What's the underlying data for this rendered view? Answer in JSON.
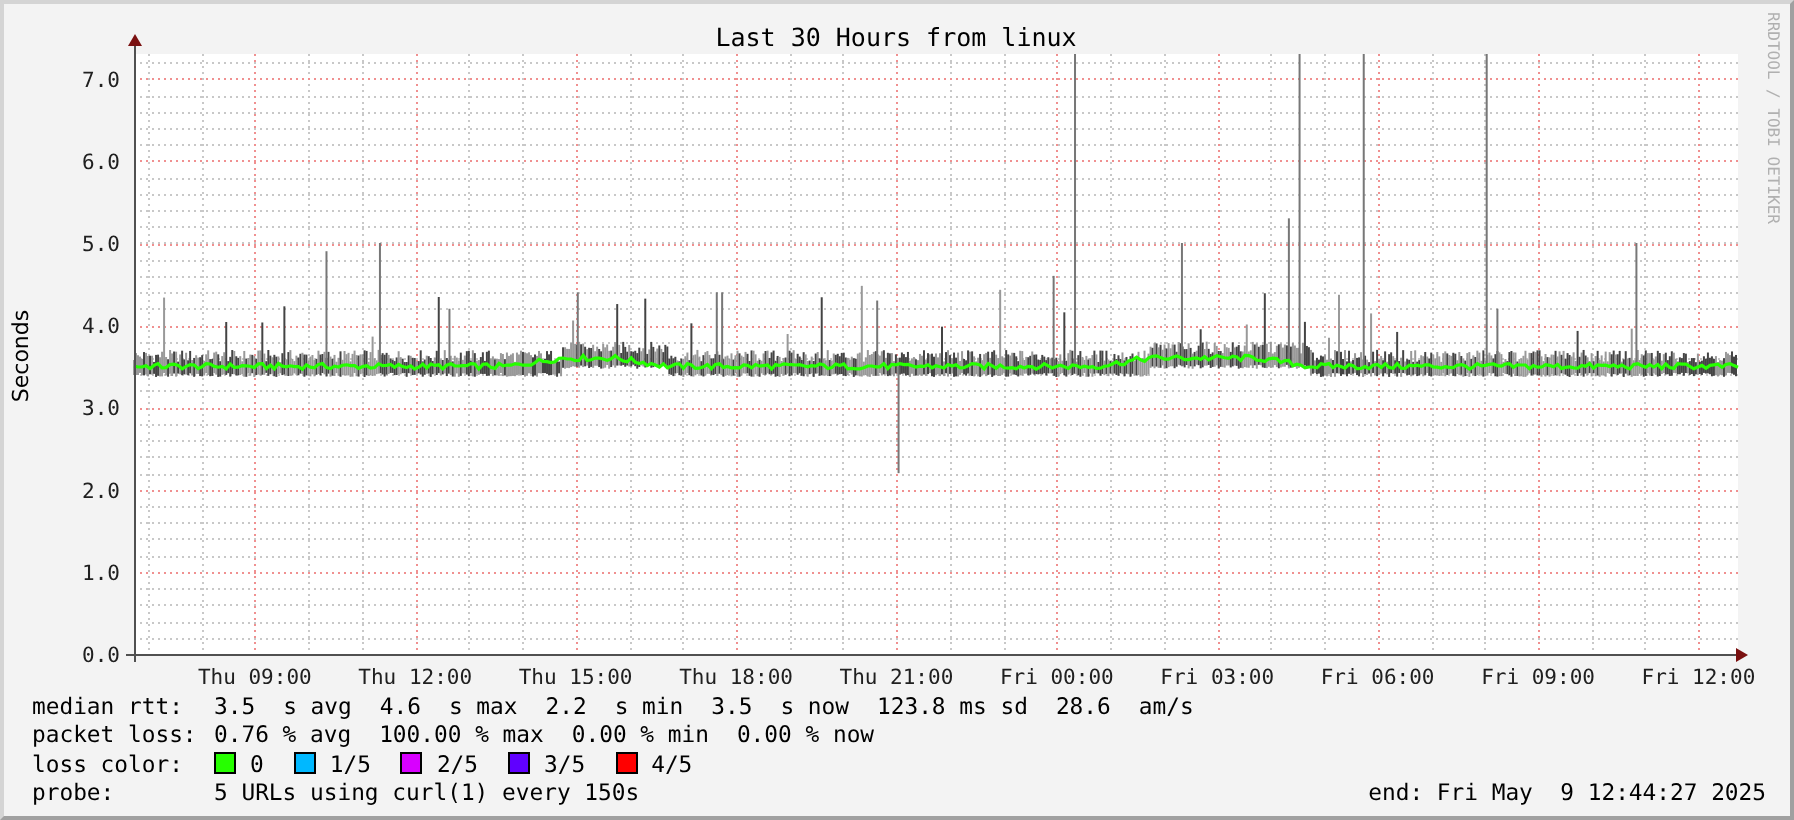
{
  "graph": {
    "credit": "RRDTOOL / TOBI OETIKER",
    "title": "Last 30 Hours from linux",
    "ylabel": "Seconds",
    "y_ticks": [
      "7.0",
      "6.0",
      "5.0",
      "4.0",
      "3.0",
      "2.0",
      "1.0",
      "0.0"
    ],
    "x_ticks": [
      "Thu 09:00",
      "Thu 12:00",
      "Thu 15:00",
      "Thu 18:00",
      "Thu 21:00",
      "Fri 00:00",
      "Fri 03:00",
      "Fri 06:00",
      "Fri 09:00",
      "Fri 12:00"
    ]
  },
  "legend": [
    {
      "kind": "stats",
      "label": "median rtt:",
      "items": [
        "3.5",
        "s avg",
        "4.6",
        "s max",
        "2.2",
        "s min",
        "3.5",
        "s now",
        "123.8 ms sd",
        "28.6",
        "am/s"
      ]
    },
    {
      "kind": "stats",
      "label": "packet loss:",
      "items": [
        "0.76 % avg",
        "100.00 % max",
        "0.00 % min",
        "0.00 % now"
      ]
    },
    {
      "kind": "colors",
      "label": "loss color:",
      "items": [
        {
          "text": "0",
          "color": "#26ff00"
        },
        {
          "text": "1/5",
          "color": "#00b8ff"
        },
        {
          "text": "2/5",
          "color": "#d800ff"
        },
        {
          "text": "3/5",
          "color": "#6000ff"
        },
        {
          "text": "4/5",
          "color": "#ff0000"
        }
      ]
    },
    {
      "kind": "probe",
      "label": "probe:",
      "text": "5 URLs using curl(1) every 150s",
      "end": "end: Fri May  9 12:44:27 2025"
    }
  ]
}
